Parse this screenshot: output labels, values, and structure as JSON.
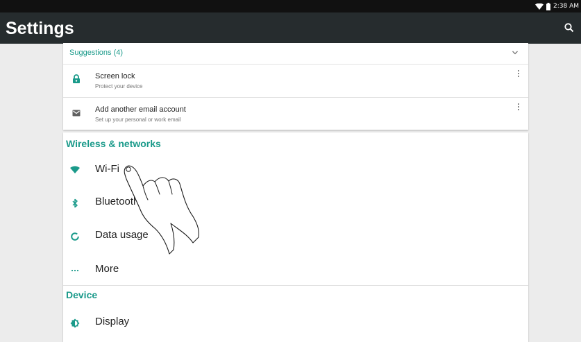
{
  "status_bar": {
    "time": "2:38 AM"
  },
  "app_bar": {
    "title": "Settings",
    "search_icon": "search-icon"
  },
  "suggestions": {
    "header": "Suggestions (4)",
    "items": [
      {
        "title": "Screen lock",
        "subtitle": "Protect your device",
        "icon": "lock-icon"
      },
      {
        "title": "Add another email account",
        "subtitle": "Set up your personal or work email",
        "icon": "email-icon"
      }
    ]
  },
  "sections": [
    {
      "title": "Wireless & networks",
      "items": [
        {
          "label": "Wi-Fi",
          "icon": "wifi-icon"
        },
        {
          "label": "Bluetooth",
          "icon": "bluetooth-icon"
        },
        {
          "label": "Data usage",
          "icon": "data-usage-icon"
        },
        {
          "label": "More",
          "icon": "more-icon"
        }
      ]
    },
    {
      "title": "Device",
      "items": [
        {
          "label": "Display",
          "icon": "display-icon"
        }
      ]
    }
  ],
  "colors": {
    "accent": "#1a9a8a",
    "app_bar": "#262c2e",
    "status_bar": "#111111",
    "background": "#ececec"
  }
}
